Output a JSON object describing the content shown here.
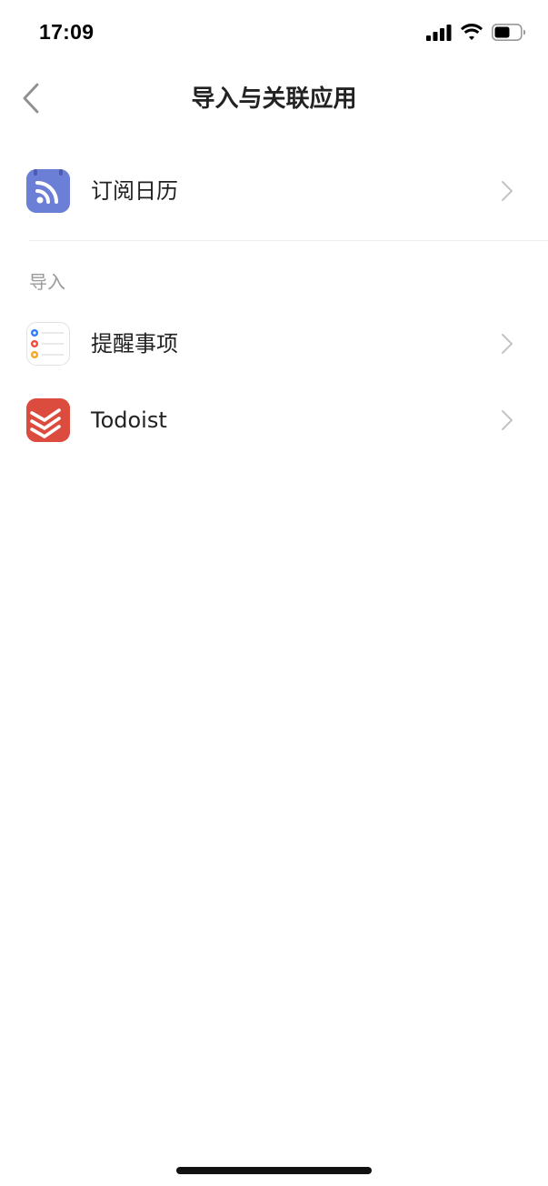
{
  "status_bar": {
    "time": "17:09",
    "icons": [
      "signal-icon",
      "wifi-icon",
      "battery-icon"
    ]
  },
  "nav": {
    "title": "导入与关联应用",
    "back_icon": "chevron-left-icon"
  },
  "subscribe": {
    "label": "订阅日历",
    "icon": "rss-calendar-icon",
    "icon_color": "#6b7fd7"
  },
  "import_section": {
    "header": "导入",
    "items": [
      {
        "label": "提醒事项",
        "icon": "reminders-app-icon"
      },
      {
        "label": "Todoist",
        "icon": "todoist-app-icon",
        "icon_color": "#db4c3f"
      }
    ]
  },
  "colors": {
    "chevron": "#c4c4c6",
    "section_header": "#9a9a9a",
    "divider": "#ececec"
  }
}
